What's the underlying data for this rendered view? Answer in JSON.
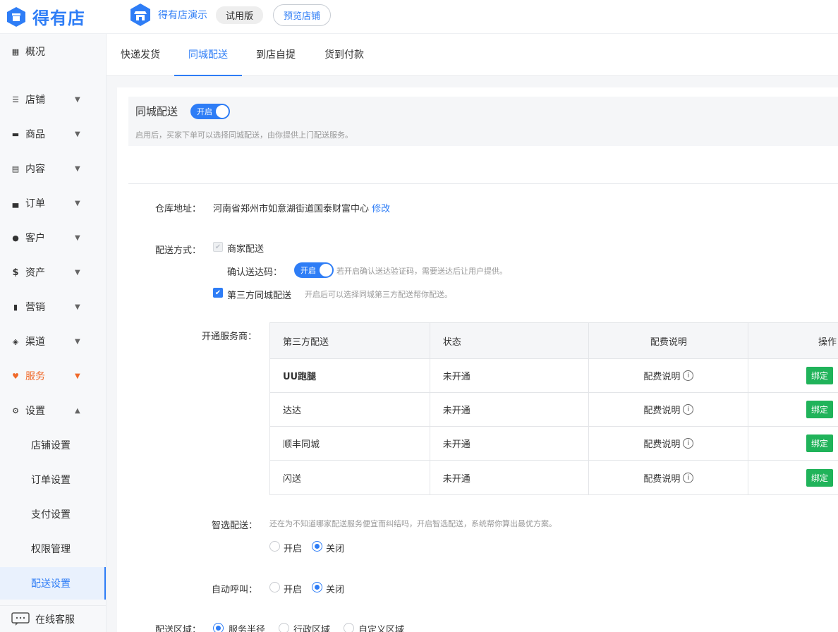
{
  "app": {
    "logo_text": "得有店",
    "shop_name": "得有店演示",
    "trial_badge": "试用版",
    "preview_button": "预览店铺"
  },
  "sidebar": {
    "items": [
      {
        "label": "概况",
        "icon": "grid-icon"
      },
      {
        "label": "店铺",
        "icon": "sliders-icon"
      },
      {
        "label": "商品",
        "icon": "box-icon"
      },
      {
        "label": "内容",
        "icon": "document-icon"
      },
      {
        "label": "订单",
        "icon": "order-icon"
      },
      {
        "label": "客户",
        "icon": "users-icon"
      },
      {
        "label": "资产",
        "icon": "dollar-icon"
      },
      {
        "label": "营销",
        "icon": "bar-chart-icon"
      },
      {
        "label": "渠道",
        "icon": "layers-icon"
      },
      {
        "label": "服务",
        "icon": "heart-icon"
      },
      {
        "label": "设置",
        "icon": "gear-icon"
      }
    ],
    "sub_items": [
      "店铺设置",
      "订单设置",
      "支付设置",
      "权限管理",
      "配送设置"
    ],
    "service_label": "在线客服",
    "accent_color": "#f06a2b"
  },
  "tabs": [
    "快递发货",
    "同城配送",
    "到店自提",
    "货到付款"
  ],
  "section": {
    "title": "同城配送",
    "switch_label": "开启",
    "description": "启用后，买家下单可以选择同城配送，由你提供上门配送服务。"
  },
  "warehouse": {
    "label": "仓库地址：",
    "address": "河南省郑州市如意湖街道国泰财富中心",
    "edit_link": "修改"
  },
  "delivery": {
    "label": "配送方式：",
    "merchant": "商家配送",
    "confirm_label": "确认送达码：",
    "confirm_switch": "开启",
    "confirm_hint": "若开启确认送达验证码，需要送达后让用户提供。",
    "third_party": "第三方同城配送",
    "third_party_hint": "开启后可以选择同城第三方配送帮你配送。"
  },
  "providers": {
    "label": "开通服务商：",
    "headers": [
      "第三方配送",
      "状态",
      "配费说明",
      "操作"
    ],
    "rows": [
      {
        "name": "UU跑腿",
        "status": "未开通",
        "fee": "配费说明",
        "action": "绑定"
      },
      {
        "name": "达达",
        "status": "未开通",
        "fee": "配费说明",
        "action": "绑定"
      },
      {
        "name": "顺丰同城",
        "status": "未开通",
        "fee": "配费说明",
        "action": "绑定"
      },
      {
        "name": "闪送",
        "status": "未开通",
        "fee": "配费说明",
        "action": "绑定"
      }
    ]
  },
  "smart": {
    "label": "智选配送：",
    "hint": "还在为不知道哪家配送服务便宜而纠结吗，开启智选配送，系统帮你算出最优方案。",
    "on": "开启",
    "off": "关闭"
  },
  "auto_call": {
    "label": "自动呼叫：",
    "on": "开启",
    "off": "关闭"
  },
  "area": {
    "label": "配送区域：",
    "options": [
      "服务半径",
      "行政区域",
      "自定义区域"
    ]
  },
  "colors": {
    "primary": "#2e7df6",
    "bind_button": "#20b35a"
  }
}
